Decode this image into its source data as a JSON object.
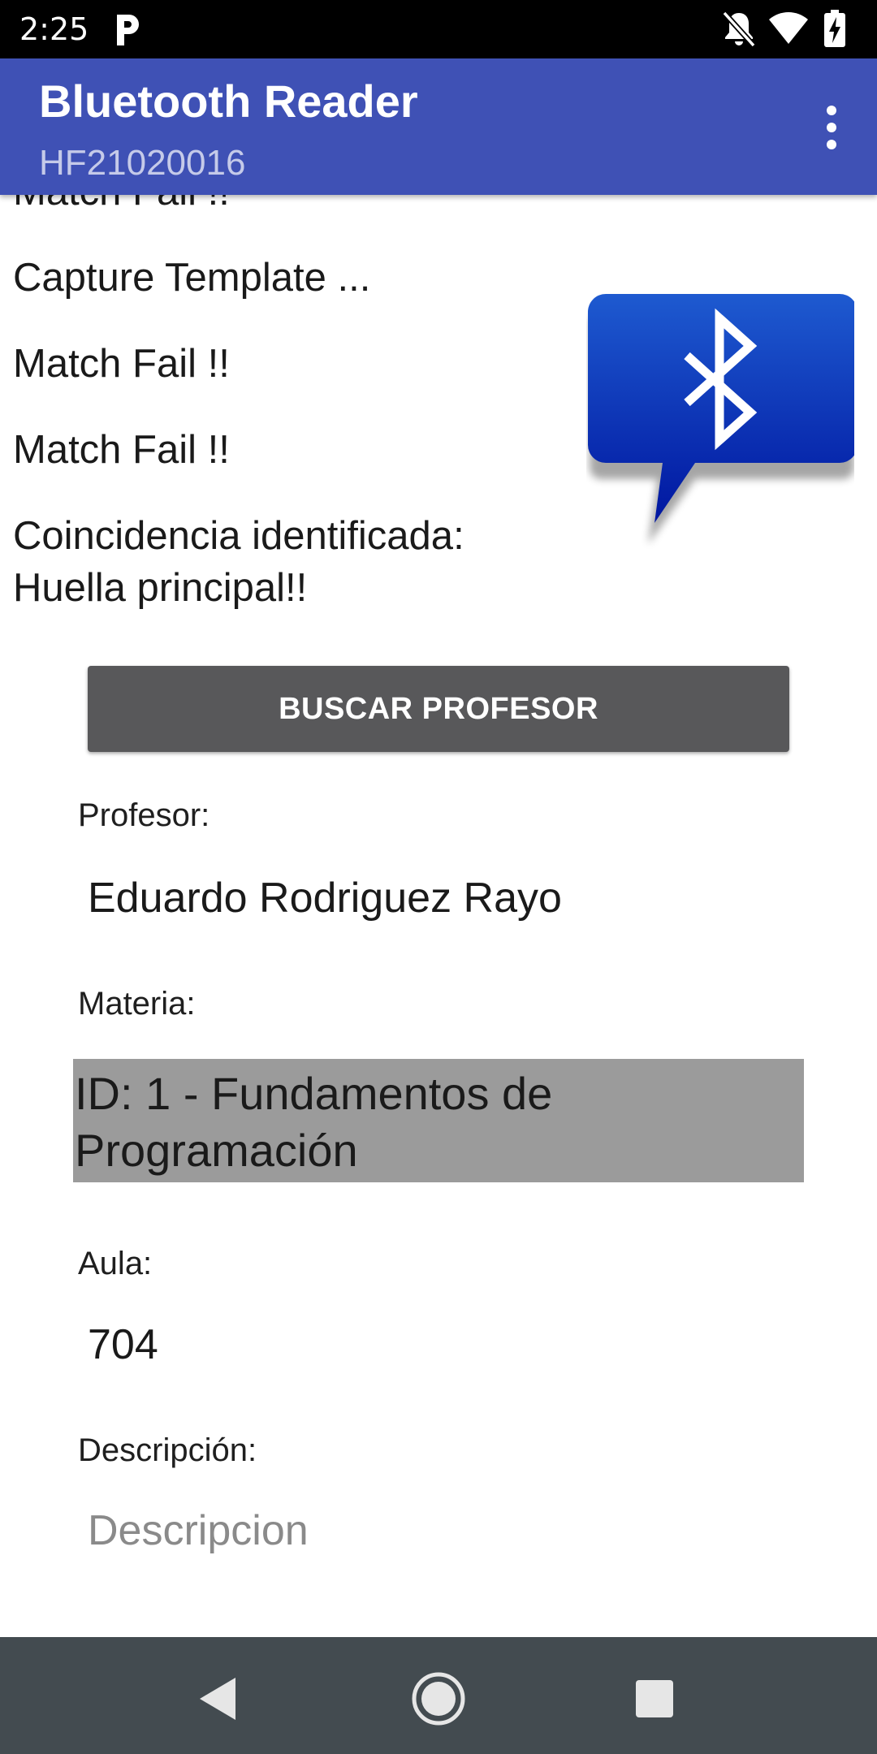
{
  "status_bar": {
    "time": "2:25",
    "icons": [
      "parking-notification-icon",
      "notifications-off-icon",
      "wifi-icon",
      "battery-charging-icon"
    ]
  },
  "app_bar": {
    "title": "Bluetooth Reader",
    "subtitle": "HF21020016",
    "menu_icon": "overflow-menu-icon",
    "color": "#3f51b5"
  },
  "log": {
    "entries": [
      "Match Fail !!",
      "Capture Template ...",
      "Match Fail !!",
      "Match Fail !!",
      "Coincidencia identificada: Huella principal!!"
    ]
  },
  "bluetooth_logo": {
    "icon": "bluetooth-chat-icon",
    "color": "#1030b0"
  },
  "search_button": {
    "label": "BUSCAR PROFESOR",
    "color": "#58585a"
  },
  "form": {
    "profesor_label": "Profesor:",
    "profesor_value": "Eduardo Rodriguez Rayo",
    "materia_label": "Materia:",
    "materia_value": "ID: 1 - Fundamentos de Programación",
    "aula_label": "Aula:",
    "aula_value": "704",
    "descripcion_label": "Descripción:",
    "descripcion_placeholder": "Descripcion"
  },
  "nav_bar": {
    "icons": [
      "back-icon",
      "home-icon",
      "recents-icon"
    ]
  }
}
